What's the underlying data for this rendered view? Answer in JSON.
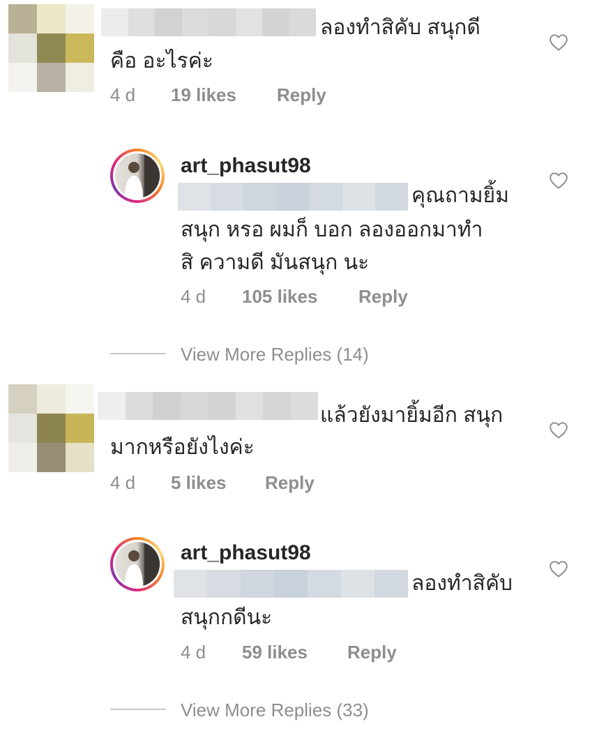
{
  "threads": [
    {
      "comment": {
        "avatar_colors": [
          "#b9b195",
          "#ece8c8",
          "#f4f2e6",
          "#e3e2db",
          "#8f8953",
          "#cab85a",
          "#f3f2ee",
          "#b8b0a2",
          "#f0ede2"
        ],
        "username_blur_colors": [
          "#ececec",
          "#dedede",
          "#d2d2d2",
          "#dcdcdc",
          "#d8d8d8",
          "#e2e2e2",
          "#d4d4d4",
          "#dadada"
        ],
        "text_line1": "ลองทำสิคับ สนุกดี",
        "text_line2": "คือ อะไรค่ะ",
        "time": "4 d",
        "likes": "19 likes",
        "reply": "Reply"
      },
      "replies": [
        {
          "username": "art_phasut98",
          "mention_blur_colors": [
            "#dfe3e8",
            "#d6dce2",
            "#cfd6dd",
            "#c9d2da",
            "#d3dae1",
            "#dde2e7",
            "#d1d8df"
          ],
          "text_line1": "คุณถามยิ้ม",
          "text_line2": "สนุก หรอ ผมก็ บอก ลองออกมาทำ",
          "text_line3": "สิ ความดี มันสนุก นะ",
          "time": "4 d",
          "likes": "105 likes",
          "reply": "Reply"
        }
      ],
      "view_more": "View More Replies (14)"
    },
    {
      "comment": {
        "avatar_colors": [
          "#d5d0c0",
          "#eeebdc",
          "#f5f4ee",
          "#e5e4de",
          "#8d854f",
          "#c8b558",
          "#efede7",
          "#978e75",
          "#e6e0c6"
        ],
        "username_blur_colors": [
          "#eeeeee",
          "#dcdcdc",
          "#d0d0d0",
          "#d8d8d8",
          "#d4d4d4",
          "#e0e0e0",
          "#d6d6d6",
          "#dcdcdc"
        ],
        "text_line1": "แล้วยังมายิ้มอีก สนุก",
        "text_line2": "มากหรือยังไงค่ะ",
        "time": "4 d",
        "likes": "5 likes",
        "reply": "Reply"
      },
      "replies": [
        {
          "username": "art_phasut98",
          "mention_blur_colors": [
            "#dfe3e8",
            "#d6dce2",
            "#cfd6dd",
            "#c9d2da",
            "#d3dae1",
            "#dde2e7",
            "#d1d8df"
          ],
          "text_line1": "ลองทำสิคับ",
          "text_line2": "สนุกกดีนะ",
          "time": "4 d",
          "likes": "59 likes",
          "reply": "Reply"
        }
      ],
      "view_more": "View More Replies (33)"
    }
  ],
  "icons": {
    "like": "heart-outline-icon"
  },
  "colors": {
    "text": "#262626",
    "meta": "#8e8e8e",
    "divider": "#c7c7c7"
  }
}
